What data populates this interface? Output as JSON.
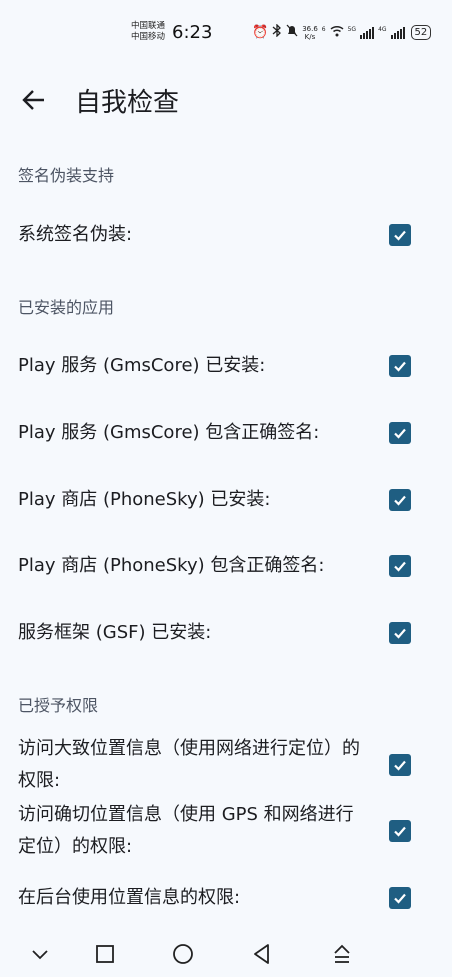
{
  "status": {
    "carrier_1": "中国联通",
    "carrier_2": "中国移动",
    "time": "6:23",
    "speed_value": "36.6",
    "speed_unit": "K/s",
    "wifi_label": "6",
    "sim1_net": "5G",
    "sim2_net": "4G",
    "battery": "52"
  },
  "app": {
    "title": "自我检查"
  },
  "sections": [
    {
      "title": "签名伪装支持",
      "items": [
        {
          "label": "系统签名伪装:",
          "checked": true
        }
      ]
    },
    {
      "title": "已安装的应用",
      "items": [
        {
          "label": "Play 服务 (GmsCore) 已安装:",
          "checked": true
        },
        {
          "label": "Play 服务 (GmsCore) 包含正确签名:",
          "checked": true
        },
        {
          "label": "Play 商店 (PhoneSky) 已安装:",
          "checked": true
        },
        {
          "label": "Play 商店 (PhoneSky) 包含正确签名:",
          "checked": true
        },
        {
          "label": "服务框架 (GSF) 已安装:",
          "checked": true
        }
      ]
    },
    {
      "title": "已授予权限",
      "items": [
        {
          "label": "访问大致位置信息（使用网络进行定位）的权限:",
          "checked": true
        },
        {
          "label": "访问确切位置信息（使用 GPS 和网络进行定位）的权限:",
          "checked": true
        },
        {
          "label": "在后台使用位置信息的权限:",
          "checked": true
        }
      ]
    }
  ],
  "colors": {
    "accent": "#1f5e82",
    "background": "#f6f9fd",
    "section_text": "#4d5564"
  }
}
